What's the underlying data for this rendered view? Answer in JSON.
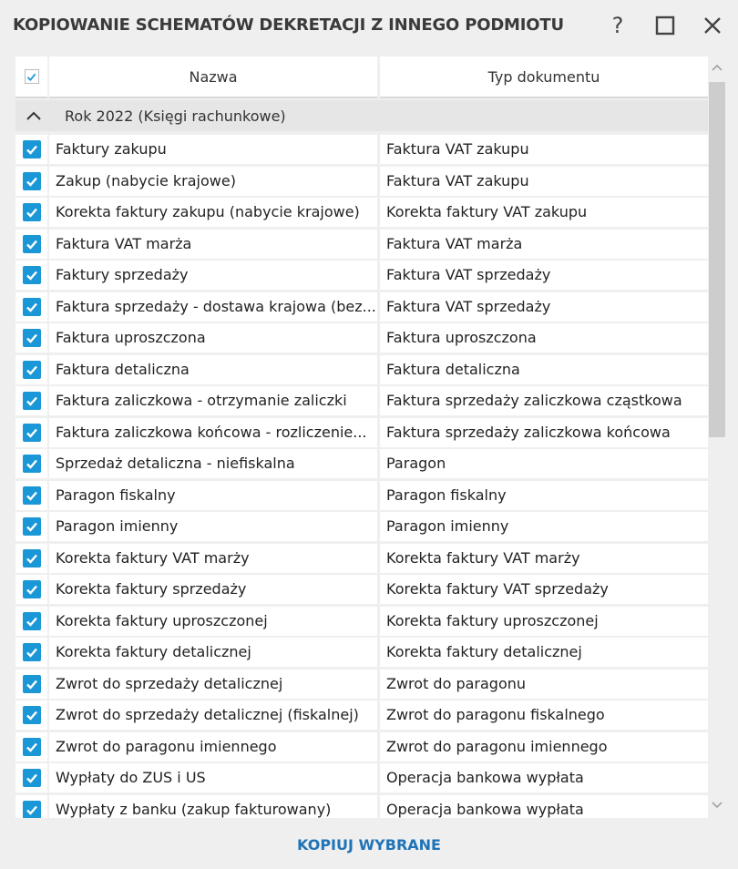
{
  "dialog": {
    "title": "KOPIOWANIE SCHEMATÓW DEKRETACJI Z INNEGO PODMIOTU",
    "help_label": "?"
  },
  "table": {
    "col_name": "Nazwa",
    "col_type": "Typ dokumentu",
    "group_label": "Rok 2022 (Księgi rachunkowe)",
    "rows": [
      {
        "name": "Faktury zakupu",
        "type": "Faktura VAT zakupu",
        "checked": true
      },
      {
        "name": "Zakup (nabycie krajowe)",
        "type": "Faktura VAT zakupu",
        "checked": true
      },
      {
        "name": "Korekta faktury zakupu (nabycie krajowe)",
        "type": "Korekta faktury VAT zakupu",
        "checked": true
      },
      {
        "name": "Faktura VAT marża",
        "type": "Faktura VAT marża",
        "checked": true
      },
      {
        "name": "Faktury sprzedaży",
        "type": "Faktura VAT sprzedaży",
        "checked": true
      },
      {
        "name": "Faktura sprzedaży - dostawa krajowa (bez...",
        "type": "Faktura VAT sprzedaży",
        "checked": true
      },
      {
        "name": "Faktura uproszczona",
        "type": "Faktura uproszczona",
        "checked": true
      },
      {
        "name": "Faktura detaliczna",
        "type": "Faktura detaliczna",
        "checked": true
      },
      {
        "name": "Faktura zaliczkowa - otrzymanie zaliczki",
        "type": "Faktura sprzedaży zaliczkowa cząstkowa",
        "checked": true
      },
      {
        "name": "Faktura zaliczkowa końcowa - rozliczenie...",
        "type": "Faktura sprzedaży zaliczkowa końcowa",
        "checked": true
      },
      {
        "name": "Sprzedaż detaliczna - niefiskalna",
        "type": "Paragon",
        "checked": true
      },
      {
        "name": "Paragon fiskalny",
        "type": "Paragon fiskalny",
        "checked": true
      },
      {
        "name": "Paragon imienny",
        "type": "Paragon imienny",
        "checked": true
      },
      {
        "name": "Korekta faktury VAT marży",
        "type": "Korekta faktury VAT marży",
        "checked": true
      },
      {
        "name": "Korekta faktury sprzedaży",
        "type": "Korekta faktury VAT sprzedaży",
        "checked": true
      },
      {
        "name": "Korekta faktury uproszczonej",
        "type": "Korekta faktury uproszczonej",
        "checked": true
      },
      {
        "name": "Korekta faktury detalicznej",
        "type": "Korekta faktury detalicznej",
        "checked": true
      },
      {
        "name": "Zwrot do sprzedaży detalicznej",
        "type": "Zwrot do paragonu",
        "checked": true
      },
      {
        "name": "Zwrot do sprzedaży detalicznej (fiskalnej)",
        "type": "Zwrot do paragonu fiskalnego",
        "checked": true
      },
      {
        "name": "Zwrot do paragonu imiennego",
        "type": "Zwrot do paragonu imiennego",
        "checked": true
      },
      {
        "name": "Wypłaty do ZUS i US",
        "type": "Operacja bankowa wypłata",
        "checked": true
      },
      {
        "name": "Wypłaty z banku (zakup fakturowany)",
        "type": "Operacja bankowa wypłata",
        "checked": true
      }
    ]
  },
  "footer": {
    "copy_label": "KOPIUJ WYBRANE"
  },
  "colors": {
    "accent": "#1a97d6",
    "link": "#1f73b7",
    "background": "#efefef"
  }
}
